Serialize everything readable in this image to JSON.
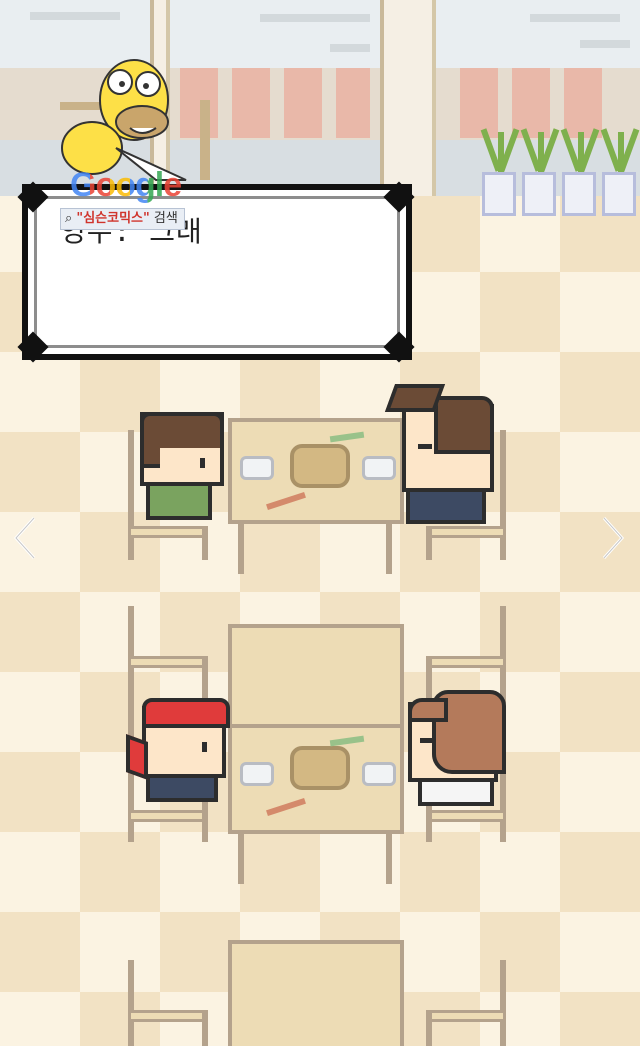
{
  "dialog": {
    "text": "영수: 그래"
  },
  "overlay": {
    "google_logo": "Google",
    "search_query": "\"심슨코믹스\"",
    "search_button": "검색"
  },
  "nav": {
    "prev_icon": "chevron-left-icon",
    "next_icon": "chevron-right-icon"
  },
  "colors": {
    "floor_light": "#fbf3e2",
    "floor_dark": "#f2e2c4",
    "table": "#eddcb5",
    "outline": "#2d2d2d"
  }
}
